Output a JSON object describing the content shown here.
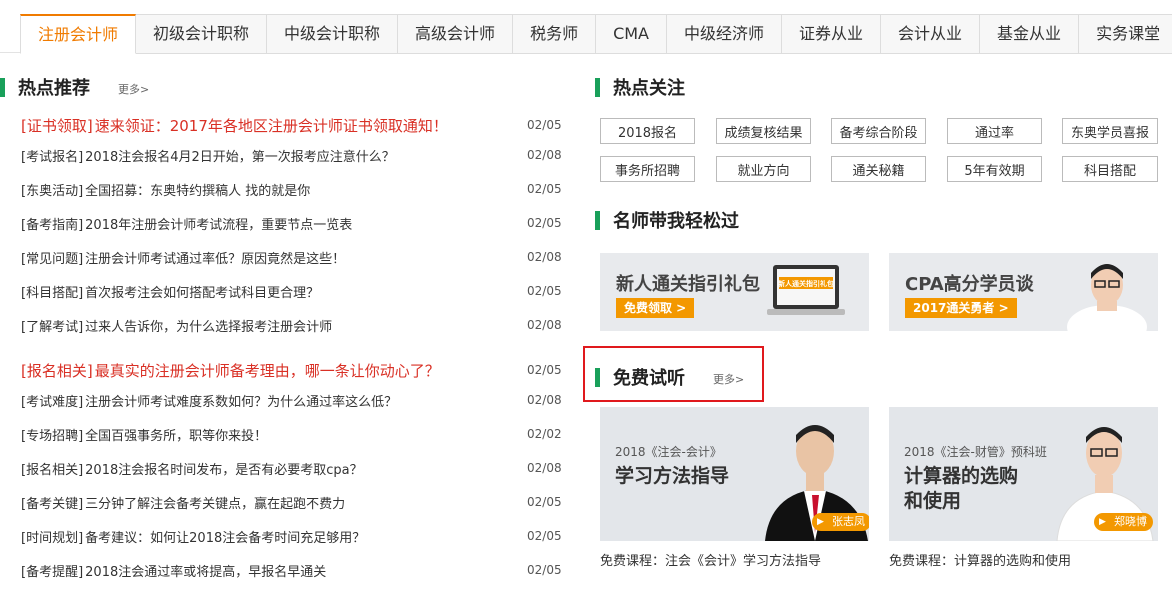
{
  "tabs": [
    "注册会计师",
    "初级会计职称",
    "中级会计职称",
    "高级会计师",
    "税务师",
    "CMA",
    "中级经济师",
    "证券从业",
    "会计从业",
    "基金从业",
    "实务课堂"
  ],
  "hot_recommend": {
    "title": "热点推荐",
    "more": "更多>",
    "rows": [
      {
        "tag": "[证书领取]",
        "title": "速来领证：2017年各地区注册会计师证书领取通知！",
        "date": "02/05",
        "hot": true
      },
      {
        "tag": "[考试报名]",
        "title": "2018注会报名4月2日开始，第一次报考应注意什么？",
        "date": "02/08",
        "hot": false
      },
      {
        "tag": "[东奥活动]",
        "title": "全国招募：东奥特约撰稿人 找的就是你",
        "date": "02/05",
        "hot": false
      },
      {
        "tag": "[备考指南]",
        "title": "2018年注册会计师考试流程，重要节点一览表",
        "date": "02/05",
        "hot": false
      },
      {
        "tag": "[常见问题]",
        "title": "注册会计师考试通过率低？原因竟然是这些！",
        "date": "02/08",
        "hot": false
      },
      {
        "tag": "[科目搭配]",
        "title": "首次报考注会如何搭配考试科目更合理？",
        "date": "02/05",
        "hot": false
      },
      {
        "tag": "[了解考试]",
        "title": "过来人告诉你，为什么选择报考注册会计师",
        "date": "02/08",
        "hot": false
      },
      {
        "tag": "[报名相关]",
        "title": "最真实的注册会计师备考理由，哪一条让你动心了？",
        "date": "02/05",
        "hot": true
      },
      {
        "tag": "[考试难度]",
        "title": "注册会计师考试难度系数如何？为什么通过率这么低？",
        "date": "02/08",
        "hot": false
      },
      {
        "tag": "[专场招聘]",
        "title": "全国百强事务所，职等你来投！",
        "date": "02/02",
        "hot": false
      },
      {
        "tag": "[报名相关]",
        "title": "2018注会报名时间发布，是否有必要考取cpa？",
        "date": "02/08",
        "hot": false
      },
      {
        "tag": "[备考关键]",
        "title": "三分钟了解注会备考关键点，赢在起跑不费力",
        "date": "02/05",
        "hot": false
      },
      {
        "tag": "[时间规划]",
        "title": "备考建议：如何让2018注会备考时间充足够用？",
        "date": "02/05",
        "hot": false
      },
      {
        "tag": "[备考提醒]",
        "title": "2018注会通过率或将提高，早报名早通关",
        "date": "02/05",
        "hot": false
      }
    ]
  },
  "hot_focus": {
    "title": "热点关注",
    "tags": [
      "2018报名",
      "成绩复核结果",
      "备考综合阶段",
      "通过率",
      "东奥学员喜报",
      "事务所招聘",
      "就业方向",
      "通关秘籍",
      "5年有效期",
      "科目搭配"
    ]
  },
  "teachers": {
    "title": "名师带我轻松过",
    "banners": [
      {
        "headline": "新人通关指引礼包",
        "button": "免费领取 >",
        "mock": "新人通关指引礼包"
      },
      {
        "headline": "CPA高分学员谈",
        "button": "2017通关勇者 >"
      }
    ]
  },
  "free_trial": {
    "title": "免费试听",
    "more": "更多>",
    "cards": [
      {
        "sub": "2018《注会-会计》",
        "big": "学习方法指导",
        "teacher": "张志凤",
        "caption": "免费课程：注会《会计》学习方法指导"
      },
      {
        "sub": "2018《注会-财管》预科班",
        "big": "计算器的选购\n和使用",
        "teacher": "郑晓博",
        "caption": "免费课程：计算器的选购和使用"
      }
    ]
  },
  "colors": {
    "accent": "#f07b00",
    "green_bar": "#19a05a",
    "hot_red": "#d93025",
    "button_orange": "#f39800",
    "highlight_box": "#e0191d"
  }
}
